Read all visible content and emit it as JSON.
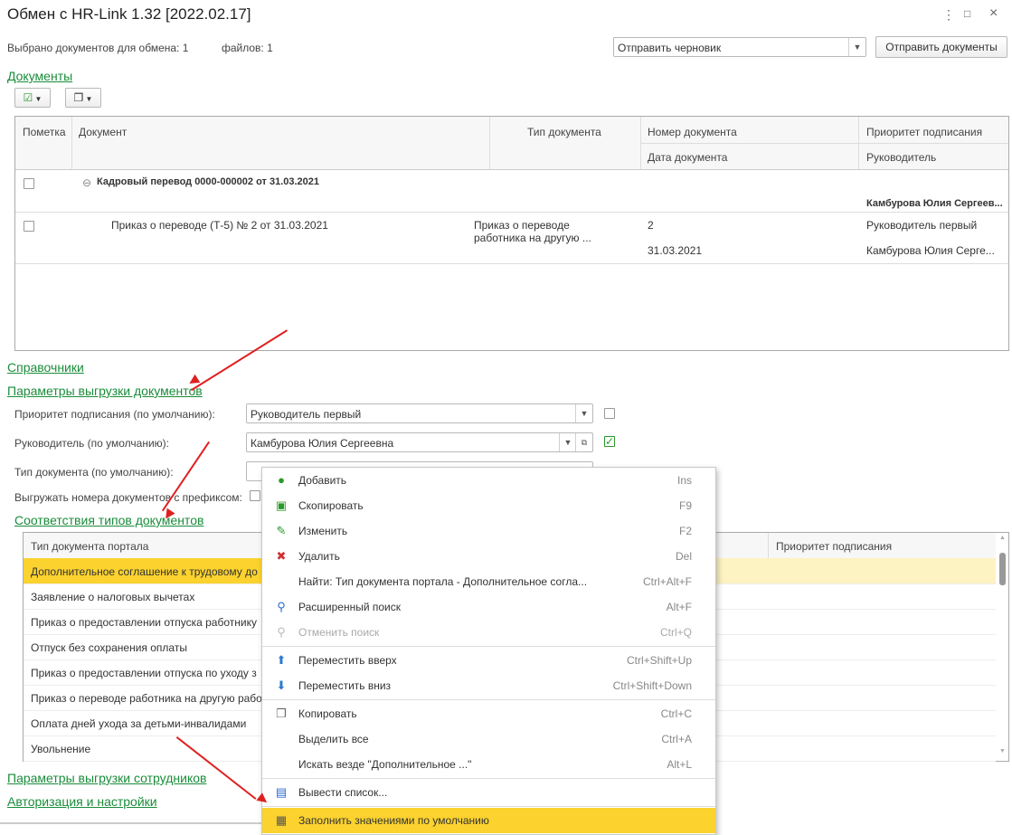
{
  "window": {
    "title": "Обмен с HR-Link 1.32 [2022.02.17]",
    "menu_icon": "⋮",
    "maximize_icon": "□",
    "close_icon": "×"
  },
  "summary": {
    "selected_docs": "Выбрано документов для обмена: 1",
    "files": "файлов: 1"
  },
  "send": {
    "mode_value": "Отправить черновик",
    "send_button": "Отправить документы"
  },
  "sections": {
    "documents": "Документы",
    "directories": "Справочники",
    "export_params": "Параметры выгрузки документов",
    "type_mapping": "Соответствия типов документов",
    "employee_params": "Параметры выгрузки сотрудников",
    "auth": "Авторизация и настройки"
  },
  "doc_table": {
    "headers": {
      "mark": "Пометка",
      "document": "Документ",
      "doc_type": "Тип документа",
      "doc_number": "Номер документа",
      "doc_date": "Дата документа",
      "priority": "Приоритет подписания",
      "manager": "Руководитель"
    },
    "group_row": {
      "title": "Кадровый перевод 0000-000002 от 31.03.2021",
      "manager": "Камбурова Юлия Сергеев..."
    },
    "row": {
      "document": "Приказ о переводе (Т-5) № 2 от 31.03.2021",
      "type_line1": "Приказ о переводе",
      "type_line2": "работника на другую ...",
      "number": "2",
      "date": "31.03.2021",
      "priority": "Руководитель первый",
      "manager": "Камбурова Юлия Серге..."
    }
  },
  "params": {
    "priority_label": "Приоритет подписания (по умолчанию):",
    "priority_value": "Руководитель первый",
    "manager_label": "Руководитель (по умолчанию):",
    "manager_value": "Камбурова Юлия Сергеевна",
    "doctype_label": "Тип документа (по умолчанию):",
    "prefix_label": "Выгружать номера документов с префиксом:"
  },
  "mapping_table": {
    "headers": {
      "portal_type": "Тип документа портала",
      "priority": "Приоритет подписания"
    },
    "rows": [
      "Дополнительное соглашение к трудовому до",
      "Заявление о налоговых вычетах",
      "Приказ о предоставлении отпуска работнику",
      "Отпуск без сохранения оплаты",
      "Приказ о предоставлении отпуска по уходу з",
      "Приказ о переводе работника на другую рабо",
      "Оплата дней ухода за детьми-инвалидами",
      "Увольнение"
    ]
  },
  "context_menu": [
    {
      "label": "Добавить",
      "shortcut": "Ins",
      "icon": "add-icon"
    },
    {
      "label": "Скопировать",
      "shortcut": "F9",
      "icon": "copy-icon"
    },
    {
      "label": "Изменить",
      "shortcut": "F2",
      "icon": "edit-icon"
    },
    {
      "label": "Удалить",
      "shortcut": "Del",
      "icon": "delete-icon"
    },
    {
      "label": "Найти: Тип документа портала - Дополнительное согла...",
      "shortcut": "Ctrl+Alt+F",
      "icon": ""
    },
    {
      "label": "Расширенный поиск",
      "shortcut": "Alt+F",
      "icon": "search-icon"
    },
    {
      "label": "Отменить поиск",
      "shortcut": "Ctrl+Q",
      "icon": "cancel-search-icon"
    },
    {
      "label": "Переместить вверх",
      "shortcut": "Ctrl+Shift+Up",
      "icon": "arrow-up-icon"
    },
    {
      "label": "Переместить вниз",
      "shortcut": "Ctrl+Shift+Down",
      "icon": "arrow-down-icon"
    },
    {
      "label": "Копировать",
      "shortcut": "Ctrl+C",
      "icon": "clipboard-icon"
    },
    {
      "label": "Выделить все",
      "shortcut": "Ctrl+A",
      "icon": ""
    },
    {
      "label": "Искать везде \"Дополнительное ...\"",
      "shortcut": "Alt+L",
      "icon": ""
    },
    {
      "label": "Вывести список...",
      "shortcut": "",
      "icon": "list-icon"
    },
    {
      "label": "Заполнить значениями по умолчанию",
      "shortcut": "",
      "icon": "fill-defaults-icon"
    }
  ],
  "colors": {
    "link_green": "#1a8c3a",
    "highlight": "#fbd22e",
    "row_selected": "#fdf2c2",
    "arrow": "#e02020"
  }
}
